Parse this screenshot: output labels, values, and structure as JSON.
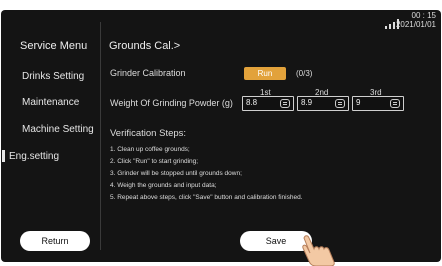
{
  "status": {
    "time": "00 : 15",
    "date": "2021/01/01"
  },
  "sidebar": {
    "title": "Service Menu",
    "items": [
      {
        "label": "Drinks Setting"
      },
      {
        "label": "Maintenance"
      },
      {
        "label": "Machine Setting"
      },
      {
        "label": "Eng.setting"
      }
    ],
    "active_index": 3,
    "return_label": "Return"
  },
  "main": {
    "title": "Grounds Cal.>",
    "calibration": {
      "label": "Grinder Calibration",
      "run_label": "Run",
      "count": "(0/3)"
    },
    "weight": {
      "label": "Weight Of Grinding Powder (g)",
      "columns": [
        "1st",
        "2nd",
        "3rd"
      ],
      "values": [
        "8.8",
        "8.9",
        "9"
      ]
    },
    "verification": {
      "title": "Verification Steps:",
      "steps": [
        "1. Clean up coffee grounds;",
        "2. Click \"Run\" to start grinding;",
        "3. Grinder will be stopped until grounds down;",
        "4. Weigh the grounds and input data;",
        "5. Repeat above steps, click \"Save\" button and calibration finished."
      ]
    },
    "save_label": "Save"
  },
  "colors": {
    "panel": "#141414",
    "accent": "#e2a23b",
    "text": "#dddddd"
  },
  "icons": [
    "signal-icon",
    "keyboard-icon",
    "pointing-hand-icon"
  ]
}
